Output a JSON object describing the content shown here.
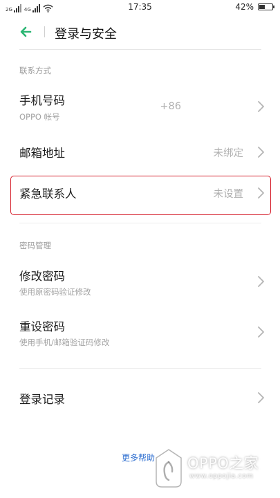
{
  "status_bar": {
    "signal1_label": "2G",
    "signal2_label": "4G",
    "time": "17:35",
    "battery_text": "42%",
    "battery_level": 0.42
  },
  "header": {
    "title": "登录与安全"
  },
  "contact_section": {
    "title": "联系方式",
    "phone": {
      "label": "手机号码",
      "sub": "OPPO 帐号",
      "value": "+86"
    },
    "email": {
      "label": "邮箱地址",
      "value": "未绑定"
    },
    "emergency": {
      "label": "紧急联系人",
      "value": "未设置"
    }
  },
  "password_section": {
    "title": "密码管理",
    "change": {
      "label": "修改密码",
      "sub": "使用原密码验证修改"
    },
    "reset": {
      "label": "重设密码",
      "sub": "使用手机/邮箱验证码修改"
    }
  },
  "login_records": {
    "label": "登录记录"
  },
  "footer": {
    "more_help": "更多帮助"
  },
  "watermark": {
    "brand": "OPPO之家",
    "url": "www.oppojia.com"
  },
  "colors": {
    "accent_green": "#2bb673",
    "link_blue": "#2f6fd0",
    "highlight_red": "#d6222e"
  },
  "icons": {
    "back": "arrow-left-icon",
    "chevron": "chevron-right-icon",
    "wifi": "wifi-icon",
    "battery": "battery-icon"
  }
}
